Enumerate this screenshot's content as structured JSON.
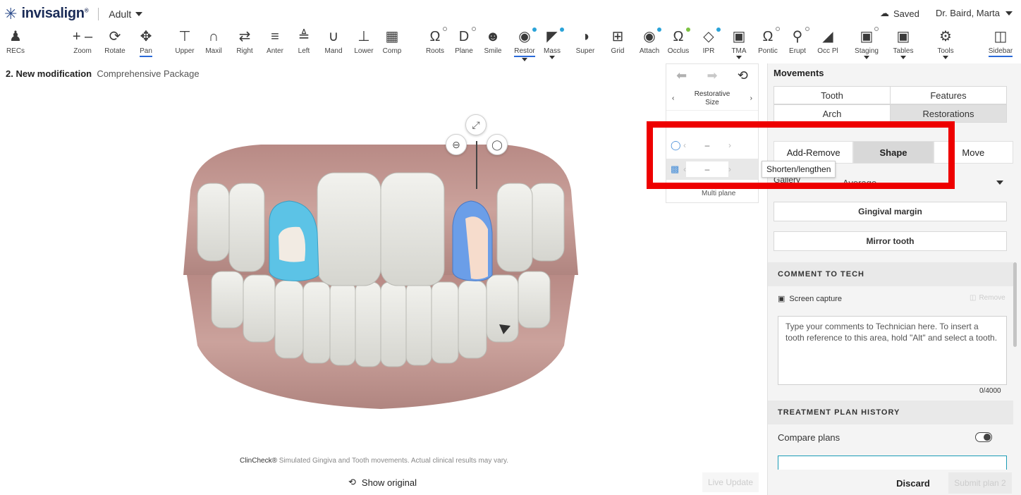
{
  "header": {
    "logo_text": "invisalign",
    "logo_mark": "®",
    "profile": "Adult",
    "saved_label": "Saved",
    "user_name": "Dr. Baird, Marta"
  },
  "toolbar": {
    "items": [
      {
        "label": "RECs"
      },
      {
        "label": "Zoom"
      },
      {
        "label": "Rotate"
      },
      {
        "label": "Pan"
      },
      {
        "label": "Upper"
      },
      {
        "label": "Maxil"
      },
      {
        "label": "Right"
      },
      {
        "label": "Anter"
      },
      {
        "label": "Left"
      },
      {
        "label": "Mand"
      },
      {
        "label": "Lower"
      },
      {
        "label": "Comp"
      },
      {
        "label": "Roots"
      },
      {
        "label": "Plane"
      },
      {
        "label": "Smile"
      },
      {
        "label": "Restor"
      },
      {
        "label": "Mass"
      },
      {
        "label": "Super"
      },
      {
        "label": "Grid"
      },
      {
        "label": "Attach"
      },
      {
        "label": "Occlus"
      },
      {
        "label": "IPR"
      },
      {
        "label": "TMA"
      },
      {
        "label": "Pontic"
      },
      {
        "label": "Erupt"
      },
      {
        "label": "Occ Pl"
      },
      {
        "label": "Staging"
      },
      {
        "label": "Tables"
      },
      {
        "label": "Tools"
      },
      {
        "label": "Sidebar"
      }
    ],
    "active": "Pan",
    "accent": "#2a6ad8"
  },
  "canvas": {
    "title": "2. New modification",
    "package": "Comprehensive Package",
    "disclaimer_brand": "ClinCheck®",
    "disclaimer_text": "Simulated Gingiva and Tooth movements. Actual clinical results may vary.",
    "show_original": "Show original",
    "live_update": "Live Update"
  },
  "midpanel": {
    "size_title_line1": "Restorative",
    "size_title_line2": "Size",
    "row1_value": "–",
    "row2_value": "–",
    "bottom_label": "Multi plane",
    "tooltip": "Shorten/lengthen"
  },
  "sidebar": {
    "heading": "Movements",
    "tabs_row1": [
      "Tooth",
      "Features"
    ],
    "tabs_row2": [
      "Arch",
      "Restorations"
    ],
    "tabs_row2_selected": "Restorations",
    "mode_tabs": [
      "Add-Remove",
      "Shape",
      "Move"
    ],
    "mode_selected": "Shape",
    "gallery_label": "Gallery",
    "gallery_value": "Average",
    "gingival_margin": "Gingival margin",
    "mirror_tooth": "Mirror tooth",
    "comment_heading": "COMMENT TO TECH",
    "screen_capture": "Screen capture",
    "remove": "Remove",
    "comment_placeholder": "Type your comments to Technician here. To insert a tooth reference to this area, hold \"Alt\" and select a tooth.",
    "counter": "0/4000",
    "history_heading": "TREATMENT PLAN HISTORY",
    "compare_plans": "Compare plans",
    "discard": "Discard",
    "submit": "Submit plan 2"
  },
  "colors": {
    "highlight_box": "#ee0000",
    "tooth_blue_left": "#5cc3e6",
    "tooth_blue_right": "#6b9ee8"
  }
}
